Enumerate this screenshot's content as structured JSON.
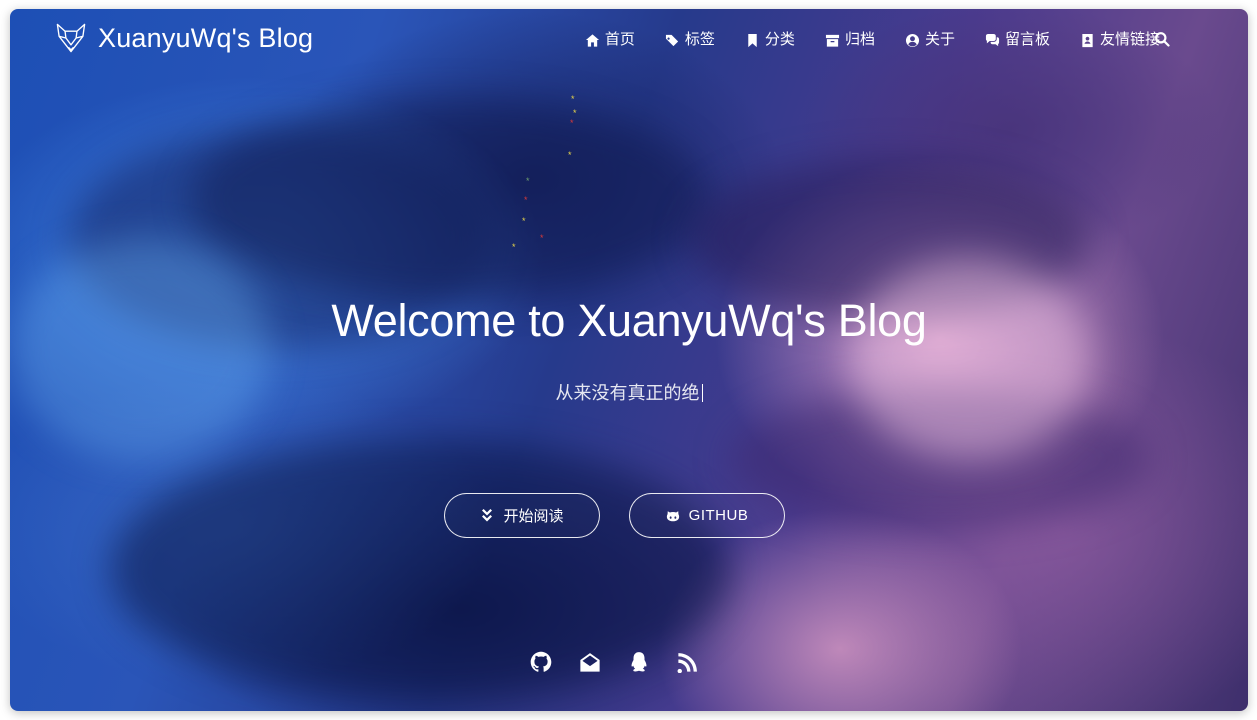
{
  "brand": {
    "title": "XuanyuWq's Blog",
    "logo_icon": "fox-head-icon"
  },
  "nav": {
    "items": [
      {
        "label": "首页",
        "icon": "home-icon"
      },
      {
        "label": "标签",
        "icon": "tags-icon"
      },
      {
        "label": "分类",
        "icon": "bookmark-icon"
      },
      {
        "label": "归档",
        "icon": "archive-icon"
      },
      {
        "label": "关于",
        "icon": "user-circle-icon"
      },
      {
        "label": "留言板",
        "icon": "comments-icon"
      },
      {
        "label": "友情链接",
        "icon": "address-book-icon"
      }
    ],
    "search_icon": "search-icon"
  },
  "hero": {
    "title": "Welcome to XuanyuWq's Blog",
    "subtitle": "从来没有真正的绝"
  },
  "buttons": {
    "read_label": "开始阅读",
    "read_icon": "angle-double-down-icon",
    "github_label": "GITHUB",
    "github_icon": "github-alt-icon"
  },
  "social": [
    "github-icon",
    "envelope-open-icon",
    "qq-icon",
    "rss-icon"
  ],
  "colors": {
    "text": "#ffffff",
    "sparkle_yellow": "#e8d64a",
    "sparkle_red": "#d83a3a",
    "sparkle_green": "#6fa06f"
  }
}
